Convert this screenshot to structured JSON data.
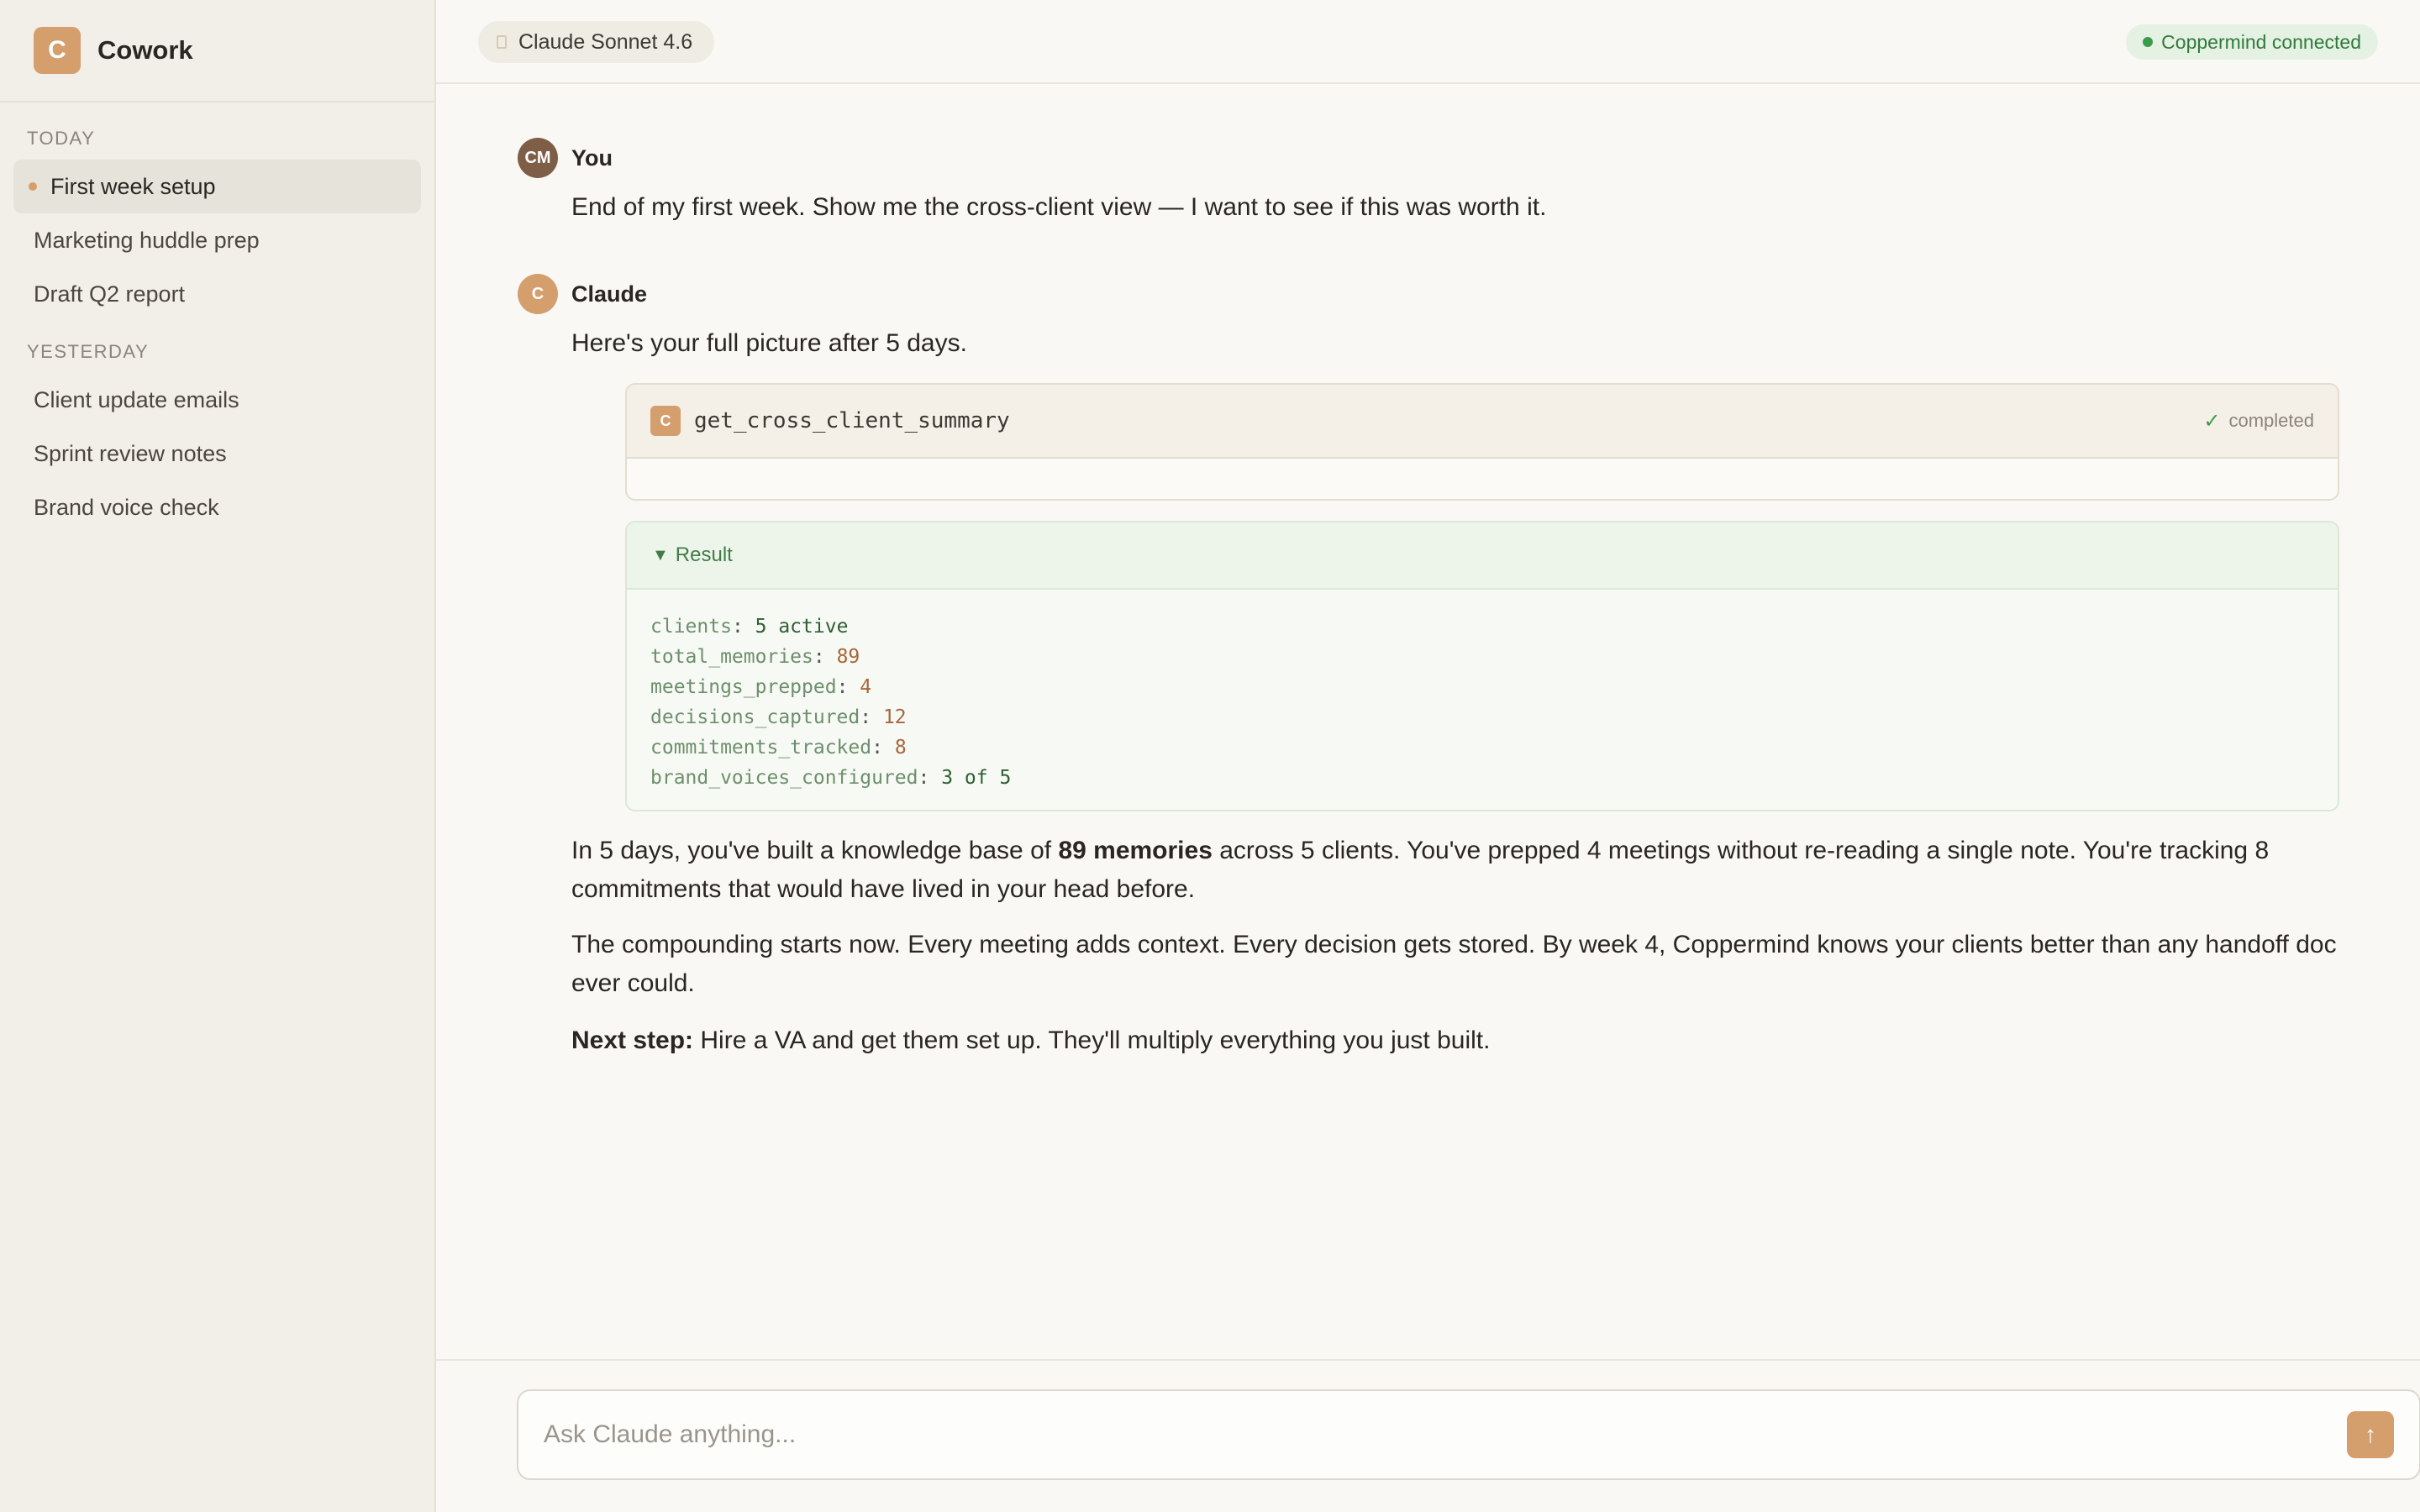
{
  "brand": {
    "logo_letter": "C",
    "name": "Cowork"
  },
  "sidebar": {
    "sections": [
      {
        "label": "TODAY",
        "items": [
          {
            "label": "First week setup",
            "active": true
          },
          {
            "label": "Marketing huddle prep"
          },
          {
            "label": "Draft Q2 report"
          }
        ]
      },
      {
        "label": "YESTERDAY",
        "items": [
          {
            "label": "Client update emails"
          },
          {
            "label": "Sprint review notes"
          },
          {
            "label": "Brand voice check"
          }
        ]
      }
    ]
  },
  "header": {
    "model": "Claude Sonnet 4.6",
    "status": "Coppermind connected"
  },
  "conversation": {
    "user": {
      "avatar": "CM",
      "name": "You",
      "text": "End of my first week. Show me the cross-client view — I want to see if this was worth it."
    },
    "assistant": {
      "avatar": "C",
      "name": "Claude",
      "intro": "Here's your full picture after 5 days.",
      "tool": {
        "icon": "C",
        "name": "get_cross_client_summary",
        "status": "completed",
        "status_icon": "✓"
      },
      "result": {
        "toggle_icon": "▼",
        "label": "Result",
        "rows": [
          {
            "key": "clients",
            "value": "5 active"
          },
          {
            "key": "total_memories",
            "value": "89"
          },
          {
            "key": "meetings_prepped",
            "value": "4"
          },
          {
            "key": "decisions_captured",
            "value": "12"
          },
          {
            "key": "commitments_tracked",
            "value": "8"
          },
          {
            "key": "brand_voices_configured",
            "value": "3 of 5"
          }
        ]
      },
      "para1": {
        "before": "In 5 days, you've built a knowledge base of ",
        "bold": "89 memories",
        "after": " across 5 clients. You've prepped 4 meetings without re-reading a single note. You're tracking 8 commitments that would have lived in your head before."
      },
      "para2": "The compounding starts now. Every meeting adds context. Every decision gets stored. By week 4, Coppermind knows your clients better than any handoff doc ever could.",
      "para3": {
        "bold": "Next step:",
        "after": " Hire a VA and get them set up. They'll multiply everything you just built."
      }
    }
  },
  "composer": {
    "placeholder": "Ask Claude anything...",
    "value": "",
    "send_icon": "↑"
  },
  "colors": {
    "accent": "#d59e6d",
    "sidebar_bg": "#f1efe8",
    "status_green": "#3a9b4b"
  }
}
